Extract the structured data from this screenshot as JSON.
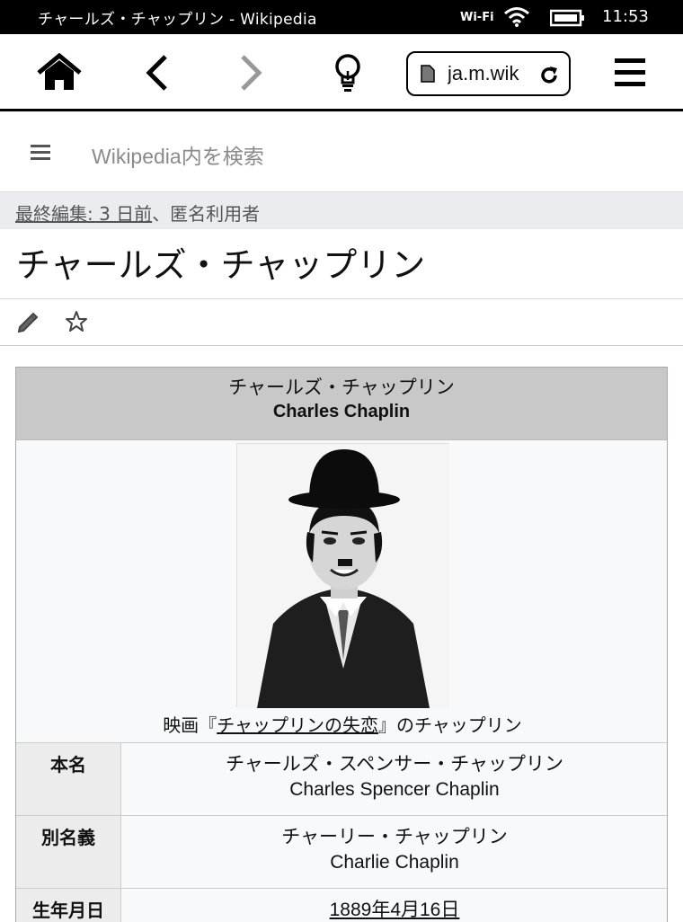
{
  "status_bar": {
    "title": "チャールズ・チャップリン - Wikipedia",
    "wifi_label": "Wi-Fi",
    "time": "11:53"
  },
  "browser": {
    "url": "ja.m.wik",
    "icons": [
      "home-icon",
      "back-icon",
      "forward-icon",
      "lightbulb-icon",
      "page-icon",
      "reload-icon",
      "menu-icon"
    ]
  },
  "wiki": {
    "search_placeholder": "Wikipedia内を検索",
    "last_edit_link": "最終編集: 3 日前",
    "last_edit_rest": "、匿名利用者",
    "page_title": "チャールズ・チャップリン"
  },
  "infobox": {
    "title_jp": "チャールズ・チャップリン",
    "title_en": "Charles Chaplin",
    "caption_prefix": "映画『",
    "caption_link": "チャップリンの失恋",
    "caption_suffix": "』のチャップリン",
    "rows": [
      {
        "label": "本名",
        "value_jp": "チャールズ・スペンサー・チャップリン",
        "value_en": "Charles Spencer Chaplin"
      },
      {
        "label": "別名義",
        "value_jp": "チャーリー・チャップリン",
        "value_en": "Charlie Chaplin"
      },
      {
        "label": "生年月日",
        "value_link": "1889年4月16日"
      }
    ]
  }
}
